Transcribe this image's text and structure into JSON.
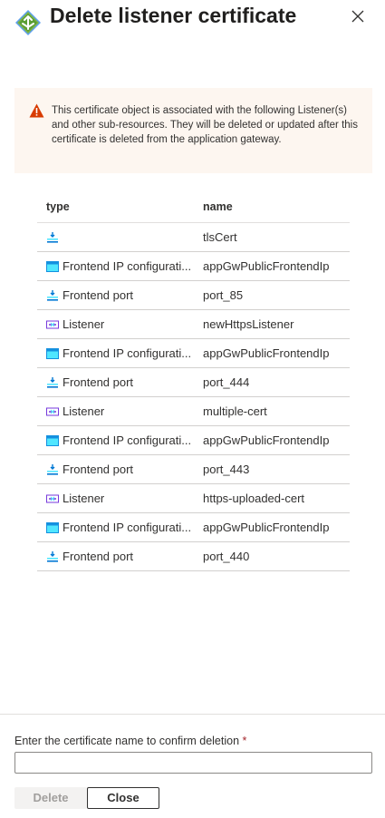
{
  "header": {
    "title": "Delete listener certificate",
    "icon": "application-gateway-icon",
    "close_icon": "close-icon"
  },
  "warning": {
    "icon": "warning-icon",
    "text": "This certificate object is associated with the following Listener(s) and other sub-resources. They will be deleted or updated after this certificate is deleted from the application gateway."
  },
  "table": {
    "headers": {
      "type": "type",
      "name": "name"
    },
    "rows": [
      {
        "icon": "port-icon",
        "type": "",
        "name": "tlsCert"
      },
      {
        "icon": "frontend-ip-icon",
        "type": "Frontend IP configurati...",
        "name": "appGwPublicFrontendIp"
      },
      {
        "icon": "port-icon",
        "type": "Frontend port",
        "name": "port_85"
      },
      {
        "icon": "listener-icon",
        "type": "Listener",
        "name": "newHttpsListener"
      },
      {
        "icon": "frontend-ip-icon",
        "type": "Frontend IP configurati...",
        "name": "appGwPublicFrontendIp"
      },
      {
        "icon": "port-icon",
        "type": "Frontend port",
        "name": "port_444"
      },
      {
        "icon": "listener-icon",
        "type": "Listener",
        "name": "multiple-cert"
      },
      {
        "icon": "frontend-ip-icon",
        "type": "Frontend IP configurati...",
        "name": "appGwPublicFrontendIp"
      },
      {
        "icon": "port-icon",
        "type": "Frontend port",
        "name": "port_443"
      },
      {
        "icon": "listener-icon",
        "type": "Listener",
        "name": "https-uploaded-cert"
      },
      {
        "icon": "frontend-ip-icon",
        "type": "Frontend IP configurati...",
        "name": "appGwPublicFrontendIp"
      },
      {
        "icon": "port-icon",
        "type": "Frontend port",
        "name": "port_440"
      }
    ]
  },
  "footer": {
    "confirm_label": "Enter the certificate name to confirm deletion",
    "required_mark": "*",
    "input_value": "",
    "delete_label": "Delete",
    "close_label": "Close"
  },
  "colors": {
    "warning_bg": "#fdf6f0",
    "warning_icon": "#d83b01",
    "required": "#a4262c",
    "frontend_ip": "#50e6ff",
    "port": "#0078d4",
    "listener": "#773adc"
  }
}
